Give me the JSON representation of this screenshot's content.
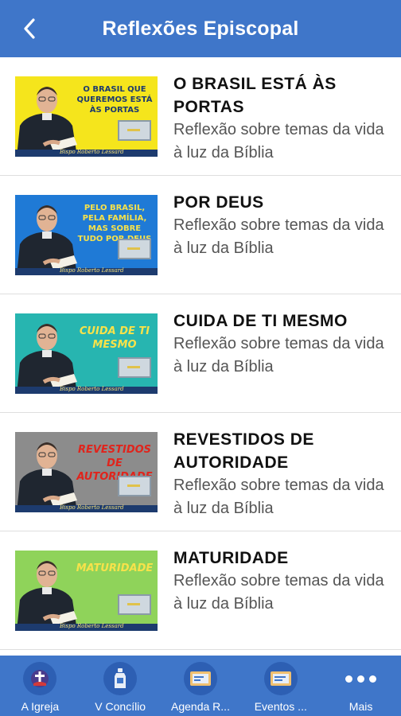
{
  "header": {
    "back_icon": "chevron-left-icon",
    "title": "Reflexões Episcopal"
  },
  "items": [
    {
      "title": "O BRASIL ESTÁ ÀS PORTAS",
      "subtitle": "Reflexão sobre temas da vida à luz da Bíblia",
      "thumb_caption": "O BRASIL QUE QUEREMOS ESTÁ ÀS PORTAS",
      "thumb_signature": "Bispo Roberto Lessard",
      "thumb_bg": "#f5e51c",
      "caption_color": "#1d3b6e"
    },
    {
      "title": "POR DEUS",
      "subtitle": "Reflexão sobre temas da vida à luz da Bíblia",
      "thumb_caption": "PELO BRASIL, PELA FAMÍLIA, MAS SOBRE TUDO POR DEUS",
      "thumb_signature": "Bispo Roberto Lessard",
      "thumb_bg": "#1f7ad6",
      "caption_color": "#f7e24a"
    },
    {
      "title": "CUIDA DE TI MESMO",
      "subtitle": "Reflexão sobre temas da vida à luz da Bíblia",
      "thumb_caption": "CUIDA DE TI MESMO",
      "thumb_signature": "Bispo Roberto Lessard",
      "thumb_bg": "#27b5b0",
      "caption_color": "#f7e24a"
    },
    {
      "title": "REVESTIDOS DE AUTORIDADE",
      "subtitle": "Reflexão sobre temas da vida à luz da Bíblia",
      "thumb_caption": "REVESTIDOS DE AUTORIDADE",
      "thumb_signature": "Bispo Roberto Lessard",
      "thumb_bg": "#8c8c8c",
      "caption_color": "#e0241c"
    },
    {
      "title": "MATURIDADE",
      "subtitle": "Reflexão sobre temas da vida à luz da Bíblia",
      "thumb_caption": "MATURIDADE",
      "thumb_signature": "Bispo Roberto Lessard",
      "thumb_bg": "#8fd35a",
      "caption_color": "#f7e24a"
    }
  ],
  "tabbar": {
    "tabs": [
      {
        "label": "A Igreja",
        "icon": "church-icon"
      },
      {
        "label": "V Concílio",
        "icon": "bottle-icon"
      },
      {
        "label": "Agenda R...",
        "icon": "calendar-card-icon"
      },
      {
        "label": "Eventos ...",
        "icon": "event-card-icon"
      },
      {
        "label": "Mais",
        "icon": "more-dots-icon"
      }
    ]
  },
  "colors": {
    "primary": "#3f76c9",
    "tab_icon_bg": "#2d5fb3"
  }
}
